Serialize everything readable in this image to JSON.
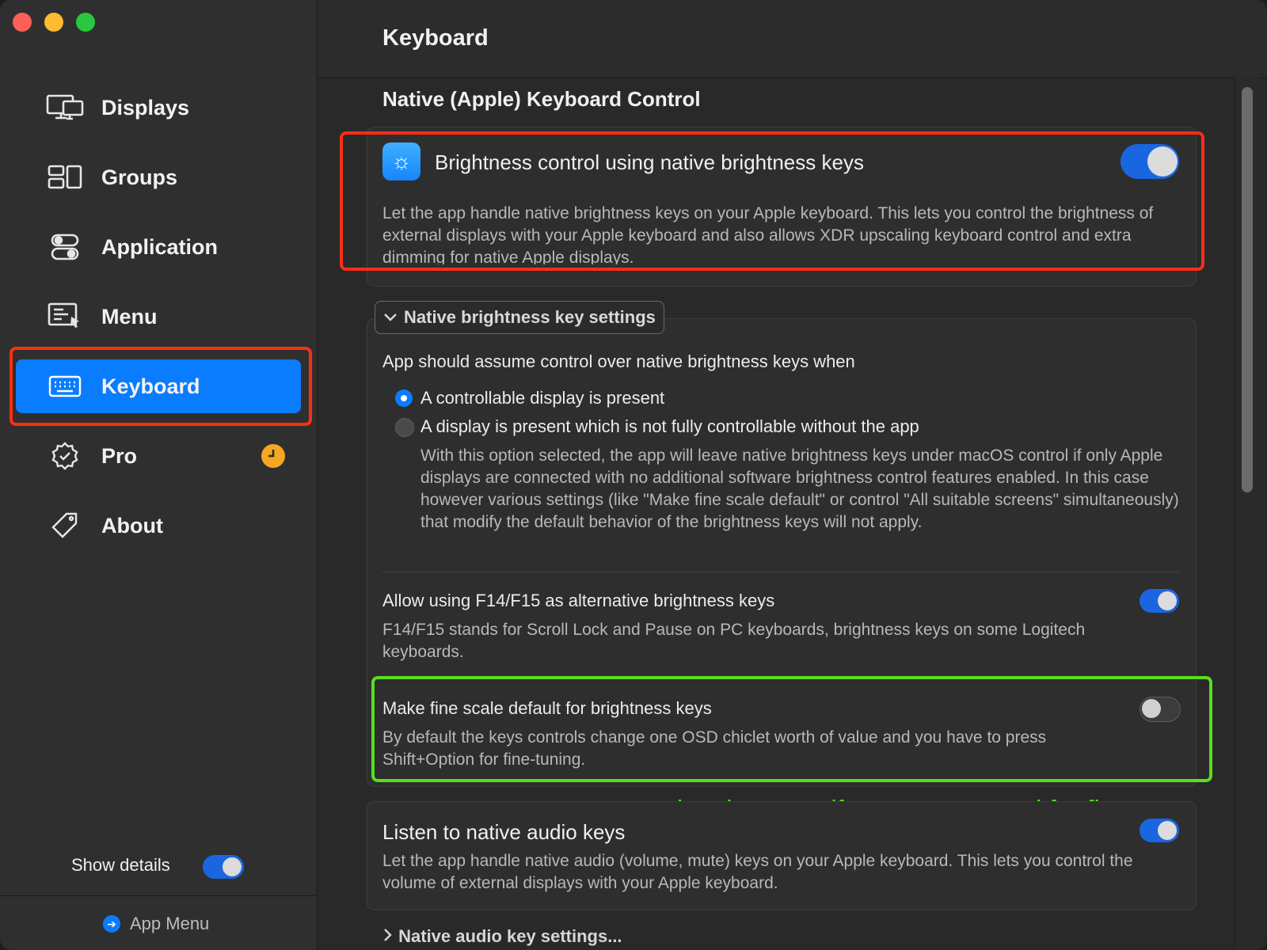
{
  "window": {
    "title": "Keyboard"
  },
  "sidebar": {
    "items": [
      {
        "label": "Displays",
        "icon": "displays-icon"
      },
      {
        "label": "Groups",
        "icon": "groups-icon"
      },
      {
        "label": "Application",
        "icon": "toggles-icon"
      },
      {
        "label": "Menu",
        "icon": "menu-icon"
      },
      {
        "label": "Keyboard",
        "icon": "keyboard-icon",
        "active": true
      },
      {
        "label": "Pro",
        "icon": "verified-badge-icon"
      },
      {
        "label": "About",
        "icon": "tag-icon"
      }
    ],
    "show_details_label": "Show details",
    "show_details_on": true,
    "app_menu_label": "App Menu"
  },
  "main": {
    "section_title": "Native (Apple) Keyboard Control",
    "brightness": {
      "title": "Brightness control using native brightness keys",
      "enabled": true,
      "description": "Let the app handle native brightness keys on your Apple keyboard. This lets you control the brightness of external displays with your Apple keyboard and also allows XDR upscaling keyboard control and extra dimming for native Apple displays."
    },
    "brightness_settings": {
      "header": "Native brightness key settings",
      "assume_label": "App should assume control over native brightness keys when",
      "options": [
        {
          "label": "A controllable display is present",
          "selected": true
        },
        {
          "label": "A display is present which is not fully controllable without the app",
          "selected": false
        }
      ],
      "option_note": "With this option selected, the app will leave native brightness keys under macOS control if only Apple displays are connected with no additional software brightness control features enabled. In this case however various settings (like \"Make fine scale default\" or control \"All suitable screens\" simultaneously) that modify the default behavior of the brightness keys will not apply.",
      "f14": {
        "title": "Allow using F14/F15 as alternative brightness keys",
        "enabled": true,
        "description": "F14/F15 stands for Scroll Lock and Pause on PC keyboards, brightness keys on some Logitech keyboards."
      },
      "fine_scale": {
        "title": "Make fine scale default for brightness keys",
        "enabled": false,
        "description": "By default the keys controls change one OSD chiclet worth of value and you have to press Shift+Option for fine-tuning."
      }
    },
    "annotation": "optional：  open if you want control for fine.",
    "audio": {
      "title": "Listen to native audio keys",
      "enabled": true,
      "description": "Let the app handle native audio (volume, mute) keys on your Apple keyboard. This lets you control the volume of external displays with your Apple keyboard."
    },
    "audio_settings_label": "Native audio key settings..."
  },
  "colors": {
    "accent": "#0a7cff",
    "highlight_red": "#ff2d14",
    "highlight_green": "#56e01c",
    "pro_badge": "#f5a623"
  }
}
